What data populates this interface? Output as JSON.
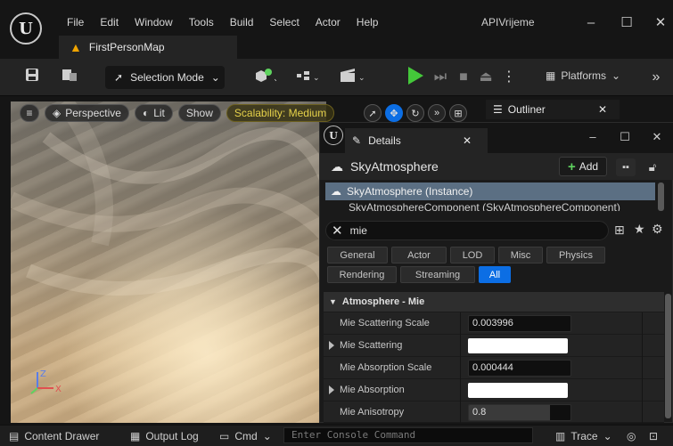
{
  "window": {
    "project_name": "APIVrijeme",
    "menu": [
      "File",
      "Edit",
      "Window",
      "Tools",
      "Build",
      "Select",
      "Actor",
      "Help"
    ],
    "map_tab": "FirstPersonMap",
    "logo_text": "U"
  },
  "toolbar": {
    "selection_mode": "Selection Mode",
    "platforms": "Platforms"
  },
  "viewport": {
    "perspective": "Perspective",
    "lit": "Lit",
    "show": "Show",
    "scalability": "Scalability: Medium",
    "axis_z": "Z",
    "axis_x": "X"
  },
  "outliner": {
    "tab_label": "Outliner"
  },
  "details": {
    "tab_label": "Details",
    "actor_name": "SkyAtmosphere",
    "add_label": "Add",
    "instance_row": "SkyAtmosphere (Instance)",
    "component_row": "SkyAtmosphereComponent (SkyAtmosphereComponent)",
    "search_value": "mie",
    "filters": [
      "General",
      "Actor",
      "LOD",
      "Misc",
      "Physics",
      "Rendering",
      "Streaming",
      "All"
    ],
    "active_filter": "All",
    "category": "Atmosphere - Mie",
    "properties": [
      {
        "label": "Mie Scattering Scale",
        "value": "0.003996"
      },
      {
        "label": "Mie Scattering",
        "value": ""
      },
      {
        "label": "Mie Absorption Scale",
        "value": "0.000444"
      },
      {
        "label": "Mie Absorption",
        "value": ""
      },
      {
        "label": "Mie Anisotropy",
        "value": "0.8"
      }
    ],
    "anisotropy_fraction": 0.8
  },
  "statusbar": {
    "content_drawer": "Content Drawer",
    "output_log": "Output Log",
    "cmd": "Cmd",
    "console_placeholder": "Enter Console Command",
    "trace": "Trace"
  },
  "colors": {
    "accent": "#0c6ee4",
    "play": "#44c83a",
    "warning": "#f0a400",
    "scalability": "#e6d24a",
    "selection_row": "#5b6f83"
  }
}
